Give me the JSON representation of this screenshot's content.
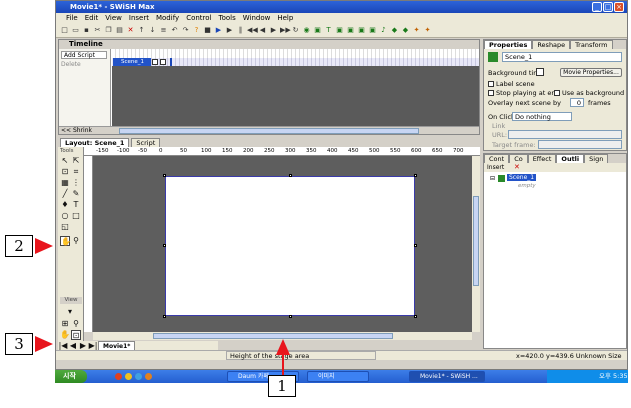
{
  "window": {
    "title": "Movie1* - SWiSH Max"
  },
  "menu": [
    "File",
    "Edit",
    "View",
    "Insert",
    "Modify",
    "Control",
    "Tools",
    "Window",
    "Help"
  ],
  "timeline": {
    "title": "Timeline",
    "add_script": "Add Script",
    "delete": "Delete",
    "scene_row": "Scene_1",
    "foot_label": "<< Shrink"
  },
  "layout": {
    "tabs": [
      "Layout: Scene_1",
      "Script"
    ],
    "tools_label": "Tools",
    "view_label": "View",
    "ruler_ticks": [
      "-150",
      "-100",
      "-50",
      "0",
      "50",
      "100",
      "150",
      "200",
      "250",
      "300",
      "350",
      "400",
      "450",
      "500",
      "550",
      "600",
      "650",
      "700"
    ],
    "scene_tab": "Movie1*",
    "status_hint": "Height of the stage area",
    "status_coords": "x=420.0 y=439.6 Unknown Size"
  },
  "properties": {
    "tabs": [
      "Properties",
      "Reshape",
      "Transform"
    ],
    "scene_name": "Scene_1",
    "background_tint": "Background tint:",
    "movie_props_btn": "Movie Properties...",
    "label_scene": "Label scene",
    "stop_playing": "Stop playing at end",
    "use_as_background": "Use as background",
    "overlay_next": "Overlay next scene by",
    "overlay_value": "0",
    "frames": "frames",
    "on_click": "On Click:",
    "on_click_value": "Do nothing",
    "link": "Link",
    "url": "URL:",
    "target_frame": "Target frame:"
  },
  "outline": {
    "tabs": [
      "Cont",
      "Co",
      "Effect",
      "Outli",
      "Sign"
    ],
    "insert": "Insert",
    "scene": "Scene_1",
    "child": "empty"
  },
  "taskbar": {
    "start": "시작",
    "tasks": [
      "Daum 카페",
      "이미지",
      "Movie1* - SWiSH ..."
    ],
    "clock": "오후 5:35"
  },
  "callouts": [
    "1",
    "2",
    "3"
  ],
  "colors": {
    "title": "#1a46b8",
    "stage_bg": "#5e5e5e",
    "arrow": "#e8141c"
  }
}
